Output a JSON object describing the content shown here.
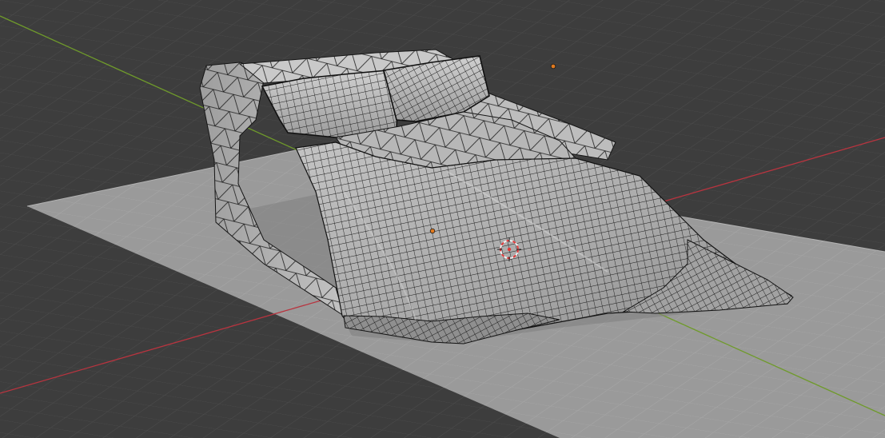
{
  "viewport": {
    "mode": "3d-viewport",
    "shading": "wireframe-overlay",
    "colors": {
      "background": "#3d3d3d",
      "grid_line": "#4a4a4a",
      "x_axis": "#b8343f",
      "y_axis": "#6f9a2b",
      "floor_plane": "#9a9a9a",
      "mesh_fill": "#b9b9b9",
      "mesh_shadow": "#7f7f7f",
      "wire": "#151515",
      "object_origin": "#e07a1f",
      "cursor_ring_red": "#e03a3a",
      "cursor_ring_white": "#f2f2f2"
    },
    "objects": [
      {
        "name": "bed-mesh",
        "kind": "mesh"
      },
      {
        "name": "floor-plane",
        "kind": "mesh"
      },
      {
        "name": "light",
        "kind": "light"
      }
    ],
    "cursor": "3d-cursor"
  }
}
